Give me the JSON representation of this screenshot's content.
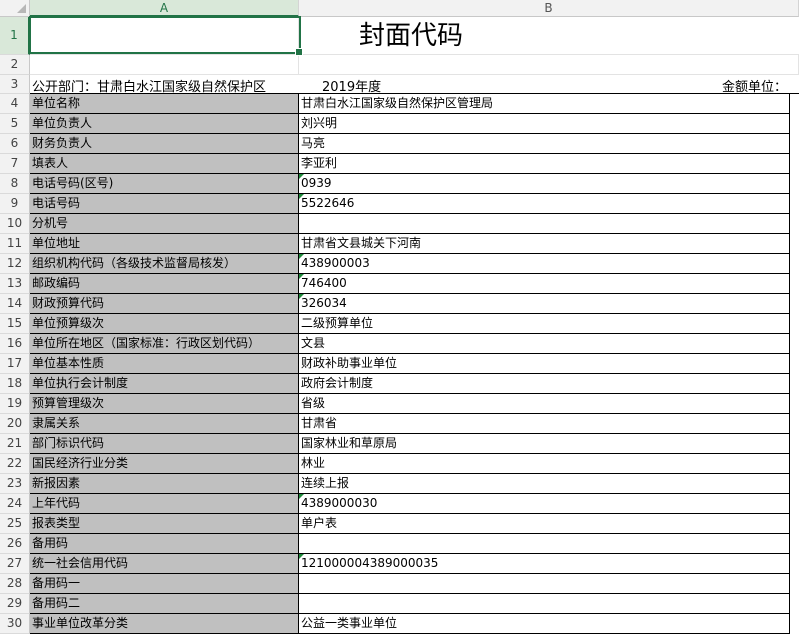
{
  "columns": [
    "A",
    "B"
  ],
  "title": "封面代码",
  "row3": {
    "dept": "公开部门：甘肃白水江国家级自然保护区",
    "year": "2019年度",
    "unit": "金额单位："
  },
  "rows": [
    {
      "num": "1"
    },
    {
      "num": "2"
    },
    {
      "num": "3"
    },
    {
      "num": "4",
      "label": "单位名称",
      "value": "甘肃白水江国家级自然保护区管理局"
    },
    {
      "num": "5",
      "label": "单位负责人",
      "value": "刘兴明"
    },
    {
      "num": "6",
      "label": "财务负责人",
      "value": "马亮"
    },
    {
      "num": "7",
      "label": "填表人",
      "value": "李亚利"
    },
    {
      "num": "8",
      "label": "电话号码(区号)",
      "value": "0939"
    },
    {
      "num": "9",
      "label": "电话号码",
      "value": "5522646"
    },
    {
      "num": "10",
      "label": "分机号",
      "value": ""
    },
    {
      "num": "11",
      "label": "单位地址",
      "value": "甘肃省文县城关下河南"
    },
    {
      "num": "12",
      "label": "组织机构代码（各级技术监督局核发）",
      "value": "438900003"
    },
    {
      "num": "13",
      "label": "邮政编码",
      "value": "746400"
    },
    {
      "num": "14",
      "label": "财政预算代码",
      "value": "326034"
    },
    {
      "num": "15",
      "label": "单位预算级次",
      "value": "二级预算单位"
    },
    {
      "num": "16",
      "label": "单位所在地区（国家标准：行政区划代码）",
      "value": "文县"
    },
    {
      "num": "17",
      "label": "单位基本性质",
      "value": "财政补助事业单位"
    },
    {
      "num": "18",
      "label": "单位执行会计制度",
      "value": "政府会计制度"
    },
    {
      "num": "19",
      "label": "预算管理级次",
      "value": "省级"
    },
    {
      "num": "20",
      "label": "隶属关系",
      "value": "甘肃省"
    },
    {
      "num": "21",
      "label": "部门标识代码",
      "value": "国家林业和草原局"
    },
    {
      "num": "22",
      "label": "国民经济行业分类",
      "value": "林业"
    },
    {
      "num": "23",
      "label": "新报因素",
      "value": "连续上报"
    },
    {
      "num": "24",
      "label": "上年代码",
      "value": "4389000030"
    },
    {
      "num": "25",
      "label": "报表类型",
      "value": "单户表"
    },
    {
      "num": "26",
      "label": "备用码",
      "value": ""
    },
    {
      "num": "27",
      "label": "统一社会信用代码",
      "value": "121000004389000035"
    },
    {
      "num": "28",
      "label": "备用码一",
      "value": ""
    },
    {
      "num": "29",
      "label": "备用码二",
      "value": ""
    },
    {
      "num": "30",
      "label": "事业单位改革分类",
      "value": "公益一类事业单位"
    }
  ]
}
